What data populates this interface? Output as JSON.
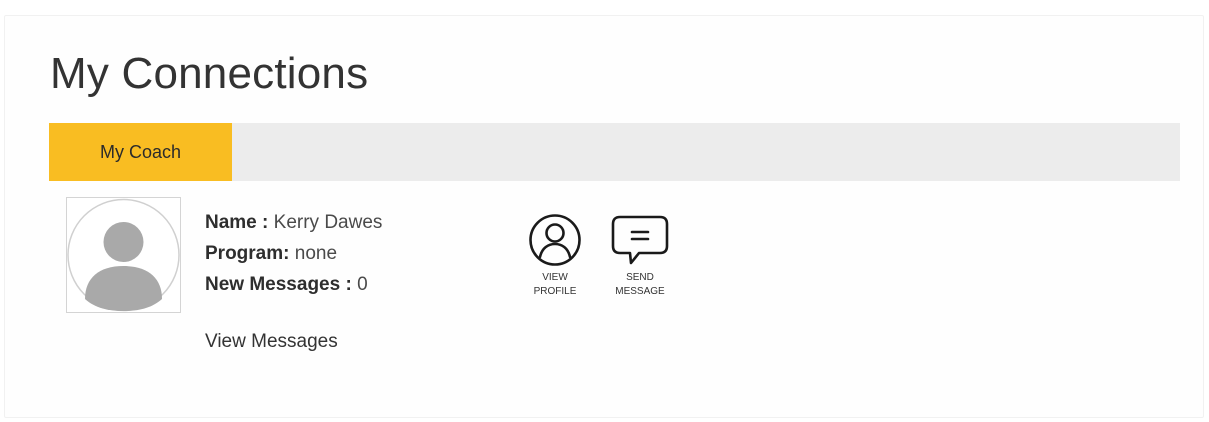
{
  "page": {
    "title": "My Connections"
  },
  "tabs": [
    {
      "label": "My Coach",
      "active": true
    }
  ],
  "connection": {
    "avatar_icon": "default-user-avatar-icon",
    "name_label": "Name :",
    "name_value": "Kerry Dawes",
    "program_label": "Program:",
    "program_value": "none",
    "new_messages_label": "New Messages :",
    "new_messages_value": "0",
    "view_messages_link": "View Messages"
  },
  "actions": {
    "view_profile": {
      "label": "VIEW PROFILE",
      "icon": "user-circle-icon"
    },
    "send_message": {
      "label": "SEND MESSAGE",
      "icon": "chat-bubble-icon"
    }
  },
  "colors": {
    "tab_active": "#f9bd22",
    "tab_bar": "#ececec",
    "avatar_gray": "#a9a9a9"
  }
}
